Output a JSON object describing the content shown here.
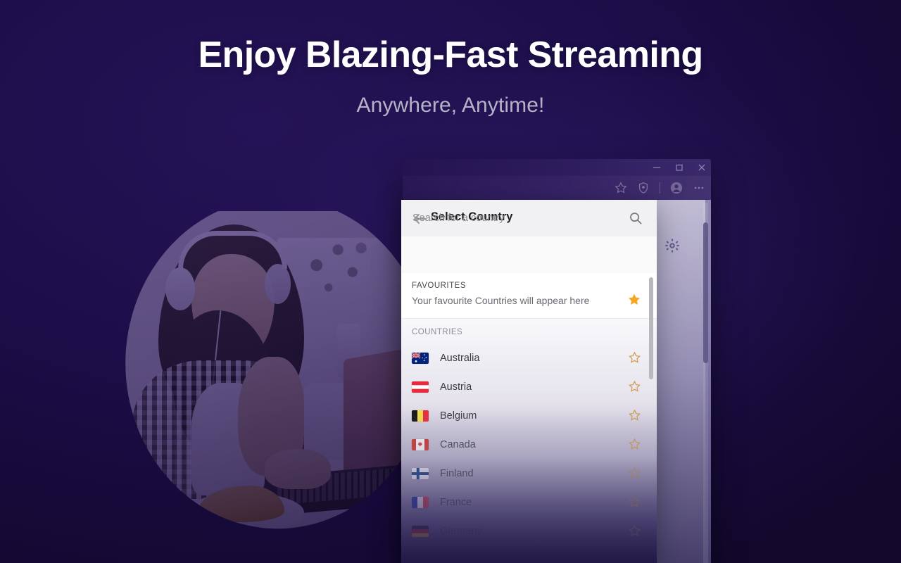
{
  "hero": {
    "headline": "Enjoy Blazing-Fast Streaming",
    "subheadline": "Anywhere, Anytime!",
    "headline_color": "#ffffff",
    "subheadline_color": "#b6b3c6",
    "background_color": "#1d0e4f"
  },
  "browser": {
    "window_controls": [
      {
        "name": "minimize",
        "glyph": "minimize-icon"
      },
      {
        "name": "restore",
        "glyph": "restore-icon"
      },
      {
        "name": "close",
        "glyph": "close-icon"
      }
    ],
    "toolbar_icons": [
      {
        "name": "favorite-star-icon"
      },
      {
        "name": "shield-icon"
      },
      {
        "name": "profile-avatar-icon"
      },
      {
        "name": "more-menu-icon"
      }
    ],
    "page_icons": [
      {
        "name": "settings-gear-icon"
      }
    ]
  },
  "dialog": {
    "back_icon": "back-arrow-icon",
    "title": "Select Country",
    "search": {
      "placeholder": "Search for a country",
      "value": "",
      "icon": "search-icon"
    },
    "favourites": {
      "label": "FAVOURITES",
      "empty_text": "Your favourite Countries will appear here",
      "star_icon": "star-filled-icon",
      "star_color": "#f5a623"
    },
    "countries": {
      "label": "COUNTRIES",
      "star_icon": "star-outline-icon",
      "star_color": "#d39a4e",
      "items": [
        {
          "name": "Australia",
          "flag": "au",
          "favourite": false
        },
        {
          "name": "Austria",
          "flag": "at",
          "favourite": false
        },
        {
          "name": "Belgium",
          "flag": "be",
          "favourite": false
        },
        {
          "name": "Canada",
          "flag": "ca",
          "favourite": false
        },
        {
          "name": "Finland",
          "flag": "fi",
          "favourite": false
        },
        {
          "name": "France",
          "flag": "fr",
          "favourite": false
        },
        {
          "name": "Germany",
          "flag": "de",
          "favourite": false
        }
      ]
    }
  }
}
